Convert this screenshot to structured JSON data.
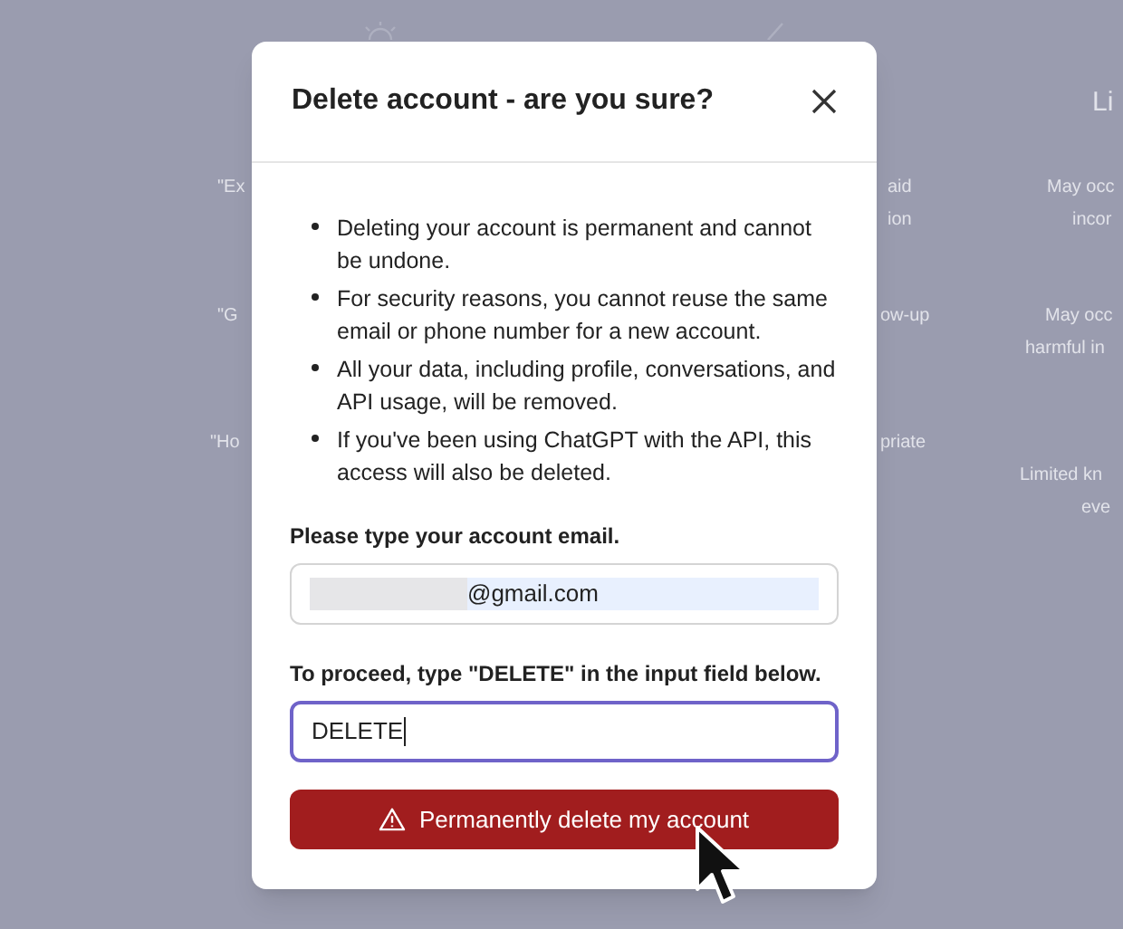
{
  "background": {
    "fragments": [
      {
        "text": "\"Ex"
      },
      {
        "text": "\"G"
      },
      {
        "text": "\"Ho"
      },
      {
        "text": "aid"
      },
      {
        "text": "ion"
      },
      {
        "text": "ow-up"
      },
      {
        "text": "priate"
      },
      {
        "text": "May occ"
      },
      {
        "text": "incor"
      },
      {
        "text": "May occ"
      },
      {
        "text": "harmful in"
      },
      {
        "text": "Limited kn"
      },
      {
        "text": "eve"
      }
    ],
    "heading": "Li"
  },
  "dialog": {
    "title": "Delete account - are you sure?",
    "bullets": [
      "Deleting your account is permanent and cannot be undone.",
      "For security reasons, you cannot reuse the same email or phone number for a new account.",
      "All your data, including profile, conversations, and API usage, will be removed.",
      "If you've been using ChatGPT with the API, this access will also be deleted."
    ],
    "email_label": "Please type your account email.",
    "email_value": "@gmail.com",
    "confirm_label": "To proceed, type \"DELETE\" in the input field below.",
    "confirm_value": "DELETE",
    "confirm_focused": true,
    "button": "Permanently delete my account"
  }
}
